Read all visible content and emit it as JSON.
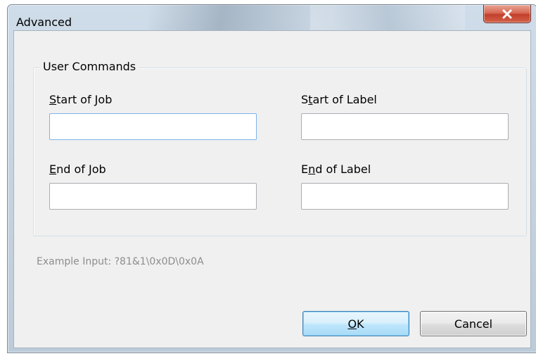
{
  "window": {
    "title": "Advanced",
    "close_icon": "close-icon"
  },
  "group": {
    "title": "User Commands"
  },
  "fields": {
    "start_of_job": {
      "label_mnemonic": "S",
      "label_rest": "tart of Job",
      "value": ""
    },
    "start_of_label": {
      "label_pre": "S",
      "label_mnemonic": "t",
      "label_rest": "art of Label",
      "value": ""
    },
    "end_of_job": {
      "label_mnemonic": "E",
      "label_rest": "nd of Job",
      "value": ""
    },
    "end_of_label": {
      "label_pre": "E",
      "label_mnemonic": "n",
      "label_rest": "d of Label",
      "value": ""
    }
  },
  "example_text": "Example Input: ?81&1\\0x0D\\0x0A",
  "buttons": {
    "ok_mnemonic": "O",
    "ok_rest": "K",
    "cancel": "Cancel"
  }
}
